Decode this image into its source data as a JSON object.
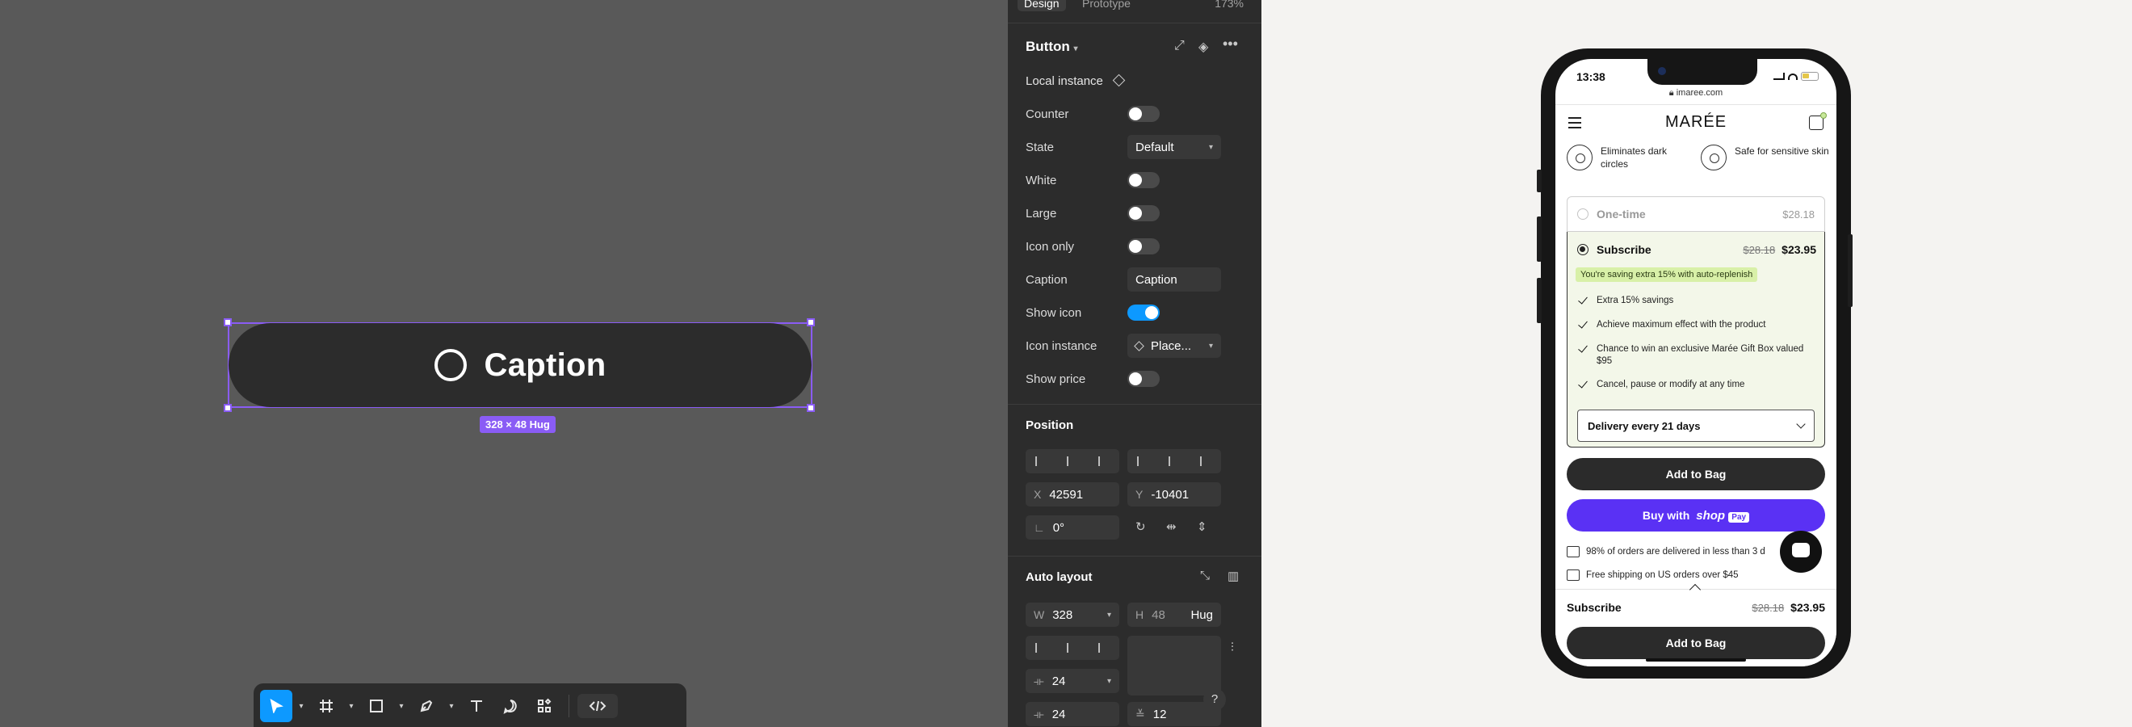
{
  "canvas": {
    "button_label": "Caption",
    "size_badge": "328 × 48 Hug"
  },
  "toolbar": {
    "tools": [
      "move-tool",
      "frame-tool",
      "shape-tool",
      "pen-tool",
      "text-tool",
      "comment-tool",
      "components-tool",
      "dev-mode-tool"
    ]
  },
  "panel": {
    "tabs": [
      "Design",
      "Prototype"
    ],
    "zoom": "173%",
    "component_name": "Button",
    "local_instance": "Local instance",
    "props": {
      "counter": "Counter",
      "state": "State",
      "state_value": "Default",
      "white": "White",
      "large": "Large",
      "icon_only": "Icon only",
      "caption": "Caption",
      "caption_value": "Caption",
      "show_icon": "Show icon",
      "icon_instance": "Icon instance",
      "icon_instance_value": "Place...",
      "show_price": "Show price"
    },
    "position": {
      "title": "Position",
      "x_label": "X",
      "x": "42591",
      "y_label": "Y",
      "y": "-10401",
      "rotation": "0°"
    },
    "auto_layout": {
      "title": "Auto layout",
      "w_label": "W",
      "w": "328",
      "h_label": "H",
      "h": "48",
      "h_mode": "Hug",
      "gap": "24",
      "padding_h": "24",
      "padding_v": "12"
    },
    "help": "?"
  },
  "phone": {
    "time": "13:38",
    "url": "imaree.com",
    "brand": "MARÉE",
    "benefits": [
      "Eliminates dark circles",
      "Safe for sensitive skin"
    ],
    "one_time_label": "One-time",
    "one_time_price": "$28.18",
    "subscribe_label": "Subscribe",
    "subscribe_old_price": "$28.18",
    "subscribe_price": "$23.95",
    "saving_badge": "You're saving extra 15% with auto-replenish",
    "checklist": [
      "Extra 15% savings",
      "Achieve maximum effect with the product",
      "Chance to win an exclusive Marée Gift Box valued $95",
      "Cancel, pause or modify at any time"
    ],
    "delivery": "Delivery every 21 days",
    "add_to_bag": "Add to Bag",
    "buy_with": "Buy with",
    "shop_mark": "shop",
    "pay_mark": "Pay",
    "info1": "98% of orders are delivered in less than 3 d",
    "info2": "Free shipping on US orders over $45",
    "sticky_label": "Subscribe",
    "sticky_old_price": "$28.18",
    "sticky_price": "$23.95",
    "sticky_add": "Add to Bag"
  },
  "colors": {
    "canvas": "#595959",
    "panel": "#2c2c2c",
    "selection": "#8a5cf5",
    "accent": "#0d99ff",
    "shoppay": "#5a31f4",
    "subscribe_bg": "#f3f7e9"
  }
}
